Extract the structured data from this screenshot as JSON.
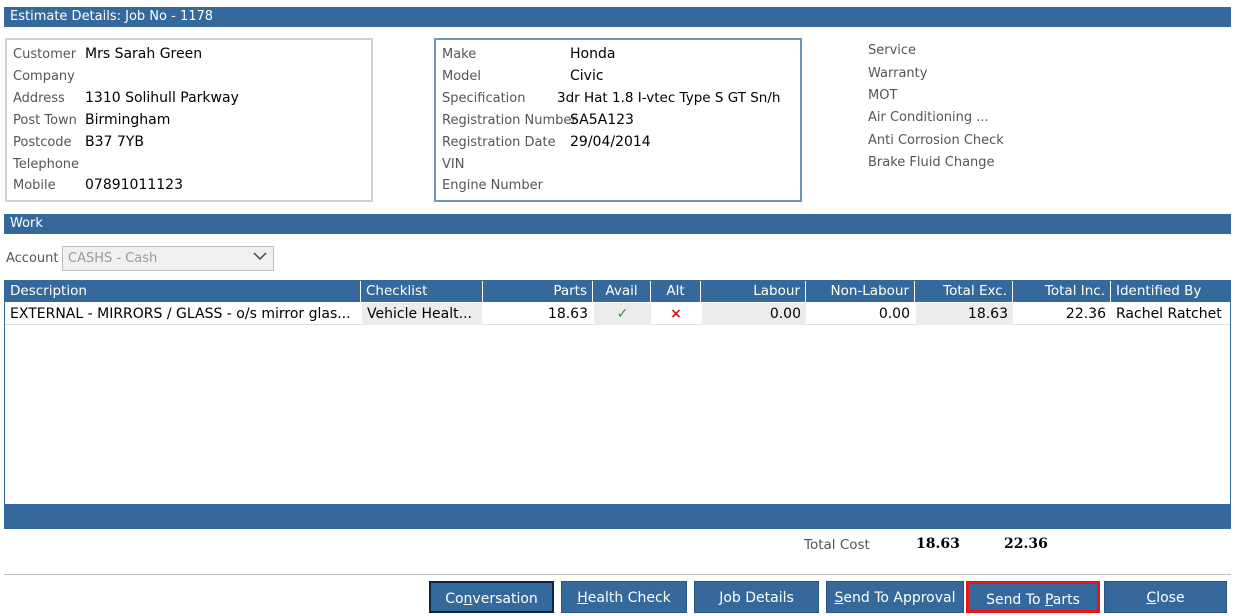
{
  "window": {
    "title": "Estimate Details: Job No - 1178"
  },
  "customer": {
    "fields": [
      {
        "label": "Customer",
        "value": "Mrs Sarah Green"
      },
      {
        "label": "Company",
        "value": ""
      },
      {
        "label": "Address",
        "value": "1310 Solihull Parkway"
      },
      {
        "label": "Post Town",
        "value": "Birmingham"
      },
      {
        "label": "Postcode",
        "value": "B37 7YB"
      },
      {
        "label": "Telephone",
        "value": ""
      },
      {
        "label": "Mobile",
        "value": "07891011123"
      }
    ]
  },
  "vehicle": {
    "fields": [
      {
        "label": "Make",
        "value": "Honda"
      },
      {
        "label": "Model",
        "value": "Civic"
      },
      {
        "label": "Specification",
        "value": "3dr Hat 1.8 I-vtec Type S GT Sn/h"
      },
      {
        "label": "Registration Number",
        "value": "SA5A123"
      },
      {
        "label": "Registration Date",
        "value": "29/04/2014"
      },
      {
        "label": "VIN",
        "value": ""
      },
      {
        "label": "Engine Number",
        "value": ""
      }
    ]
  },
  "services": [
    "Service",
    "Warranty",
    "MOT",
    "Air Conditioning ...",
    "Anti Corrosion Check",
    "Brake Fluid Change"
  ],
  "work": {
    "section_title": "Work",
    "account_label": "Account",
    "account_value": "CASHS - Cash",
    "columns": [
      "Description",
      "Checklist",
      "Parts",
      "Avail",
      "Alt",
      "Labour",
      "Non-Labour",
      "Total Exc.",
      "Total Inc.",
      "Identified By"
    ],
    "rows": [
      {
        "description": "EXTERNAL - MIRRORS / GLASS - o/s mirror glas...",
        "checklist": "Vehicle Healt...",
        "parts": "18.63",
        "avail": "✓",
        "alt": "×",
        "labour": "0.00",
        "non_labour": "0.00",
        "total_exc": "18.63",
        "total_inc": "22.36",
        "identified_by": "Rachel Ratchet"
      }
    ]
  },
  "totals": {
    "label": "Total Cost",
    "exc": "18.63",
    "inc": "22.36"
  },
  "buttons": {
    "conversation": {
      "pre": "Co",
      "key": "n",
      "post": "versation"
    },
    "health_check": {
      "pre": "",
      "key": "H",
      "post": "ealth Check"
    },
    "job_details": {
      "pre": "",
      "key": "J",
      "post": "ob Details"
    },
    "send_to_approval": {
      "pre": "",
      "key": "S",
      "post": "end To Approval"
    },
    "send_to_parts": {
      "pre": "Send To ",
      "key": "P",
      "post": "arts"
    },
    "close": {
      "pre": "",
      "key": "C",
      "post": "lose"
    }
  },
  "colors": {
    "accent": "#35689b",
    "avail_ok": "#2a9d2a",
    "alt_no": "#d9151e",
    "highlight": "#e8141d"
  }
}
